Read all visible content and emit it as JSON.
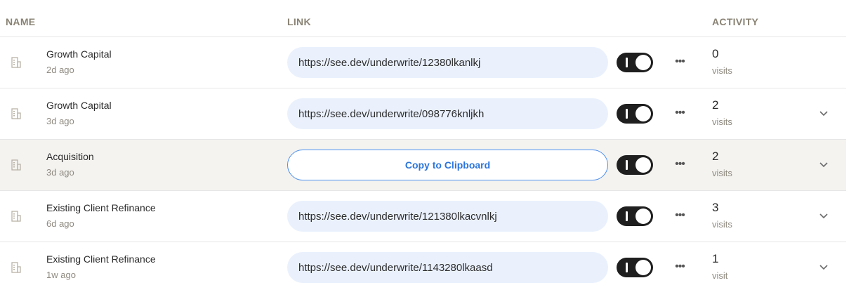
{
  "header": {
    "name": "NAME",
    "link": "LINK",
    "activity": "ACTIVITY"
  },
  "rows": [
    {
      "name": "Growth Capital",
      "time": "2d ago",
      "link": "https://see.dev/underwrite/12380lkanlkj",
      "count": "0",
      "unit": "visits",
      "expandable": false,
      "highlighted": false
    },
    {
      "name": "Growth Capital",
      "time": "3d ago",
      "link": "https://see.dev/underwrite/098776knljkh",
      "count": "2",
      "unit": "visits",
      "expandable": true,
      "highlighted": false
    },
    {
      "name": "Acquisition",
      "time": "3d ago",
      "link": "Copy to Clipboard",
      "count": "2",
      "unit": "visits",
      "expandable": true,
      "highlighted": true
    },
    {
      "name": "Existing Client Refinance",
      "time": "6d ago",
      "link": "https://see.dev/underwrite/121380lkacvnlkj",
      "count": "3",
      "unit": "visits",
      "expandable": true,
      "highlighted": false
    },
    {
      "name": "Existing Client Refinance",
      "time": "1w ago",
      "link": "https://see.dev/underwrite/1143280lkaasd",
      "count": "1",
      "unit": "visit",
      "expandable": true,
      "highlighted": false
    }
  ],
  "icons": {
    "row": "building-icon",
    "menu": "more-horizontal-icon",
    "expand": "chevron-down-icon",
    "toggle": "toggle-switch-on"
  },
  "colors": {
    "link_bg": "#eaf1fd",
    "accent_blue": "#2b74dc",
    "toggle_on": "#1f1f1f",
    "row_highlight": "#f4f3f0"
  }
}
